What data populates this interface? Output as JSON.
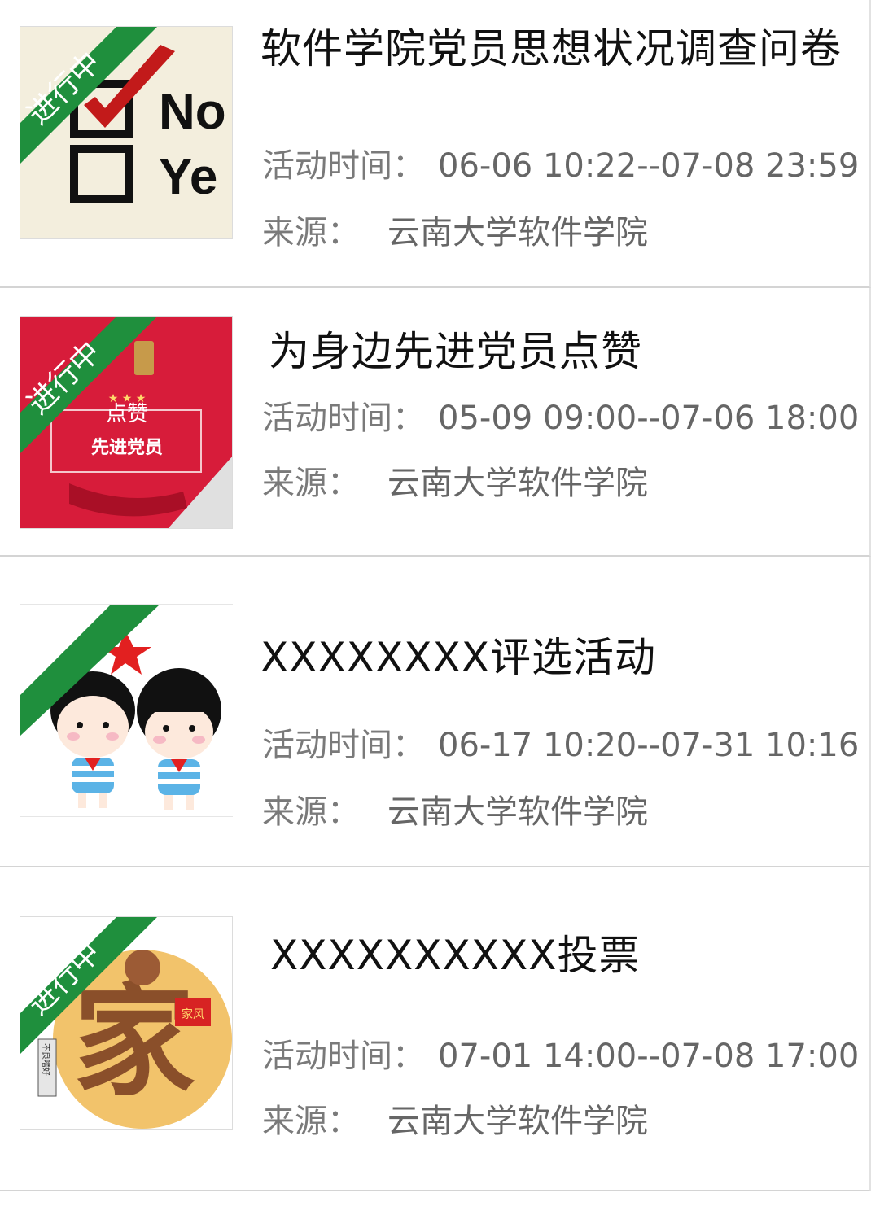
{
  "status_badge": "进行中",
  "time_label": "活动时间：",
  "source_label": "来源：",
  "colors": {
    "badge_green": "#1f8f3d",
    "title": "#111111",
    "meta": "#666666",
    "divider": "#d4d4d4"
  },
  "items": [
    {
      "title": "软件学院党员思想状况调查问卷",
      "time": "06-06 10:22--07-08 23:59",
      "source": "云南大学软件学院",
      "thumb_icon": "checkbox-no-yes-icon",
      "thumb_text": [
        "No",
        "Ye"
      ]
    },
    {
      "title": "为身边先进党员点赞",
      "time": "05-09 09:00--07-06 18:00",
      "source": "云南大学软件学院",
      "thumb_icon": "like-advanced-member-banner-icon",
      "thumb_text": [
        "点赞",
        "先进党员"
      ]
    },
    {
      "title": "XXXXXXXX评选活动",
      "time": "06-17 10:20--07-31 10:16",
      "source": "云南大学软件学院",
      "thumb_icon": "saluting-children-icon"
    },
    {
      "title": "XXXXXXXXXX投票",
      "time": "07-01 14:00--07-08 17:00",
      "source": "云南大学软件学院",
      "thumb_icon": "family-character-icon",
      "thumb_text": [
        "家",
        "家风",
        "不良嗜好"
      ]
    }
  ]
}
